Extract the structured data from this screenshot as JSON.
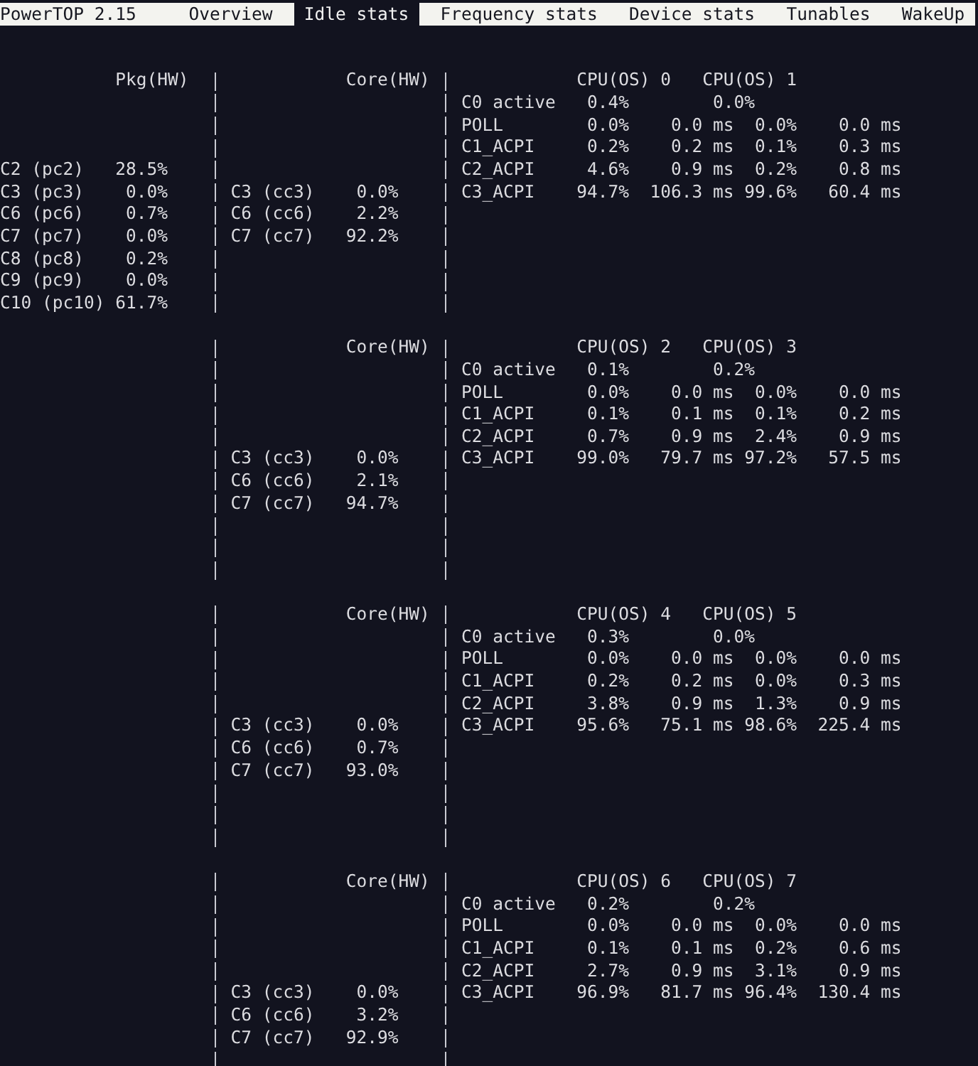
{
  "app": {
    "title": "PowerTOP 2.15"
  },
  "tabs": [
    {
      "label": "Overview",
      "selected": false
    },
    {
      "label": "Idle stats",
      "selected": true
    },
    {
      "label": "Frequency stats",
      "selected": false
    },
    {
      "label": "Device stats",
      "selected": false
    },
    {
      "label": "Tunables",
      "selected": false
    },
    {
      "label": "WakeUp",
      "selected": false
    }
  ],
  "package": {
    "header": "Pkg(HW)",
    "states": [
      {
        "name": "C2 (pc2)",
        "value": "28.5%"
      },
      {
        "name": "C3 (pc3)",
        "value": "0.0%"
      },
      {
        "name": "C6 (pc6)",
        "value": "0.7%"
      },
      {
        "name": "C7 (pc7)",
        "value": "0.0%"
      },
      {
        "name": "C8 (pc8)",
        "value": "0.2%"
      },
      {
        "name": "C9 (pc9)",
        "value": "0.0%"
      },
      {
        "name": "C10 (pc10)",
        "value": "61.7%"
      }
    ]
  },
  "cores": [
    {
      "header": "Core(HW)",
      "states": [
        {
          "name": "C3 (cc3)",
          "value": "0.0%"
        },
        {
          "name": "C6 (cc6)",
          "value": "2.2%"
        },
        {
          "name": "C7 (cc7)",
          "value": "92.2%"
        }
      ],
      "cpus": [
        "CPU(OS) 0",
        "CPU(OS) 1"
      ],
      "rows": [
        {
          "kind": "active",
          "name": "C0 active",
          "cells": [
            {
              "percent": "0.4%"
            },
            {
              "percent": "0.0%"
            }
          ]
        },
        {
          "kind": "state",
          "name": "POLL",
          "cells": [
            {
              "percent": "0.0%",
              "time": "0.0 ms"
            },
            {
              "percent": "0.0%",
              "time": "0.0 ms"
            }
          ]
        },
        {
          "kind": "state",
          "name": "C1_ACPI",
          "cells": [
            {
              "percent": "0.2%",
              "time": "0.2 ms"
            },
            {
              "percent": "0.1%",
              "time": "0.3 ms"
            }
          ]
        },
        {
          "kind": "state",
          "name": "C2_ACPI",
          "cells": [
            {
              "percent": "4.6%",
              "time": "0.9 ms"
            },
            {
              "percent": "0.2%",
              "time": "0.8 ms"
            }
          ]
        },
        {
          "kind": "state",
          "name": "C3_ACPI",
          "cells": [
            {
              "percent": "94.7%",
              "time": "106.3 ms"
            },
            {
              "percent": "99.6%",
              "time": "60.4 ms"
            }
          ]
        }
      ]
    },
    {
      "header": "Core(HW)",
      "states": [
        {
          "name": "C3 (cc3)",
          "value": "0.0%"
        },
        {
          "name": "C6 (cc6)",
          "value": "2.1%"
        },
        {
          "name": "C7 (cc7)",
          "value": "94.7%"
        }
      ],
      "cpus": [
        "CPU(OS) 2",
        "CPU(OS) 3"
      ],
      "rows": [
        {
          "kind": "active",
          "name": "C0 active",
          "cells": [
            {
              "percent": "0.1%"
            },
            {
              "percent": "0.2%"
            }
          ]
        },
        {
          "kind": "state",
          "name": "POLL",
          "cells": [
            {
              "percent": "0.0%",
              "time": "0.0 ms"
            },
            {
              "percent": "0.0%",
              "time": "0.0 ms"
            }
          ]
        },
        {
          "kind": "state",
          "name": "C1_ACPI",
          "cells": [
            {
              "percent": "0.1%",
              "time": "0.1 ms"
            },
            {
              "percent": "0.1%",
              "time": "0.2 ms"
            }
          ]
        },
        {
          "kind": "state",
          "name": "C2_ACPI",
          "cells": [
            {
              "percent": "0.7%",
              "time": "0.9 ms"
            },
            {
              "percent": "2.4%",
              "time": "0.9 ms"
            }
          ]
        },
        {
          "kind": "state",
          "name": "C3_ACPI",
          "cells": [
            {
              "percent": "99.0%",
              "time": "79.7 ms"
            },
            {
              "percent": "97.2%",
              "time": "57.5 ms"
            }
          ]
        }
      ]
    },
    {
      "header": "Core(HW)",
      "states": [
        {
          "name": "C3 (cc3)",
          "value": "0.0%"
        },
        {
          "name": "C6 (cc6)",
          "value": "0.7%"
        },
        {
          "name": "C7 (cc7)",
          "value": "93.0%"
        }
      ],
      "cpus": [
        "CPU(OS) 4",
        "CPU(OS) 5"
      ],
      "rows": [
        {
          "kind": "active",
          "name": "C0 active",
          "cells": [
            {
              "percent": "0.3%"
            },
            {
              "percent": "0.0%"
            }
          ]
        },
        {
          "kind": "state",
          "name": "POLL",
          "cells": [
            {
              "percent": "0.0%",
              "time": "0.0 ms"
            },
            {
              "percent": "0.0%",
              "time": "0.0 ms"
            }
          ]
        },
        {
          "kind": "state",
          "name": "C1_ACPI",
          "cells": [
            {
              "percent": "0.2%",
              "time": "0.2 ms"
            },
            {
              "percent": "0.0%",
              "time": "0.3 ms"
            }
          ]
        },
        {
          "kind": "state",
          "name": "C2_ACPI",
          "cells": [
            {
              "percent": "3.8%",
              "time": "0.9 ms"
            },
            {
              "percent": "1.3%",
              "time": "0.9 ms"
            }
          ]
        },
        {
          "kind": "state",
          "name": "C3_ACPI",
          "cells": [
            {
              "percent": "95.6%",
              "time": "75.1 ms"
            },
            {
              "percent": "98.6%",
              "time": "225.4 ms"
            }
          ]
        }
      ]
    },
    {
      "header": "Core(HW)",
      "states": [
        {
          "name": "C3 (cc3)",
          "value": "0.0%"
        },
        {
          "name": "C6 (cc6)",
          "value": "3.2%"
        },
        {
          "name": "C7 (cc7)",
          "value": "92.9%"
        }
      ],
      "cpus": [
        "CPU(OS) 6",
        "CPU(OS) 7"
      ],
      "rows": [
        {
          "kind": "active",
          "name": "C0 active",
          "cells": [
            {
              "percent": "0.2%"
            },
            {
              "percent": "0.2%"
            }
          ]
        },
        {
          "kind": "state",
          "name": "POLL",
          "cells": [
            {
              "percent": "0.0%",
              "time": "0.0 ms"
            },
            {
              "percent": "0.0%",
              "time": "0.0 ms"
            }
          ]
        },
        {
          "kind": "state",
          "name": "C1_ACPI",
          "cells": [
            {
              "percent": "0.1%",
              "time": "0.1 ms"
            },
            {
              "percent": "0.2%",
              "time": "0.6 ms"
            }
          ]
        },
        {
          "kind": "state",
          "name": "C2_ACPI",
          "cells": [
            {
              "percent": "2.7%",
              "time": "0.9 ms"
            },
            {
              "percent": "3.1%",
              "time": "0.9 ms"
            }
          ]
        },
        {
          "kind": "state",
          "name": "C3_ACPI",
          "cells": [
            {
              "percent": "96.9%",
              "time": "81.7 ms"
            },
            {
              "percent": "96.4%",
              "time": "130.4 ms"
            }
          ]
        }
      ]
    }
  ]
}
